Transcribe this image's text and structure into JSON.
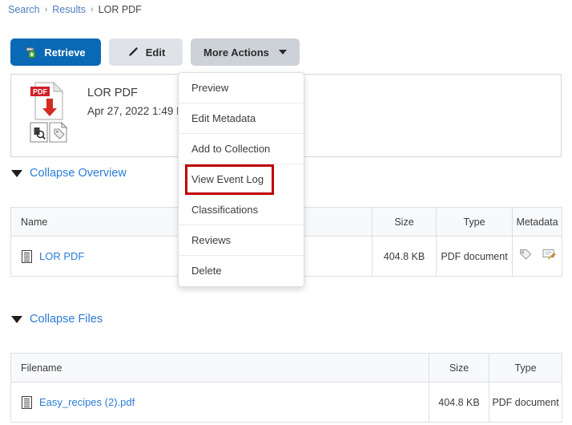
{
  "breadcrumb": {
    "items": [
      {
        "label": "Search",
        "link": true
      },
      {
        "label": "Results",
        "link": true
      },
      {
        "label": "LOR PDF",
        "link": false
      }
    ],
    "separator": "›"
  },
  "toolbar": {
    "retrieve_label": "Retrieve",
    "edit_label": "Edit",
    "more_actions_label": "More Actions",
    "primary_color": "#0a69b4",
    "secondary_color": "#dfe3e8",
    "tertiary_color": "#cdd2d8"
  },
  "document": {
    "title": "LOR PDF",
    "date": "Apr 27, 2022 1:49 PM by SYS LOR",
    "icon": "pdf-download-icon"
  },
  "overview": {
    "collapse_label": "Collapse Overview",
    "columns": [
      "Name",
      "",
      "Size",
      "Type",
      "Metadata"
    ],
    "rows": [
      {
        "name": "LOR PDF",
        "blank": "",
        "size": "404.8 KB",
        "type": "PDF document",
        "metadata_icons": [
          "tag-icon",
          "annotation-icon"
        ]
      }
    ]
  },
  "files": {
    "collapse_label": "Collapse Files",
    "columns": [
      "Filename",
      "Size",
      "Type"
    ],
    "rows": [
      {
        "filename": "Easy_recipes (2).pdf",
        "size": "404.8 KB",
        "type": "PDF document"
      }
    ]
  },
  "dropdown": {
    "open": true,
    "highlight_color": "#c00000",
    "highlighted_item": "View Event Log",
    "items": [
      {
        "label": "Preview"
      },
      {
        "label": "Edit Metadata"
      },
      {
        "label": "Add to Collection"
      },
      {
        "label": "View Event Log"
      },
      {
        "label": "Classifications"
      },
      {
        "label": "Reviews"
      },
      {
        "label": "Delete"
      }
    ]
  }
}
